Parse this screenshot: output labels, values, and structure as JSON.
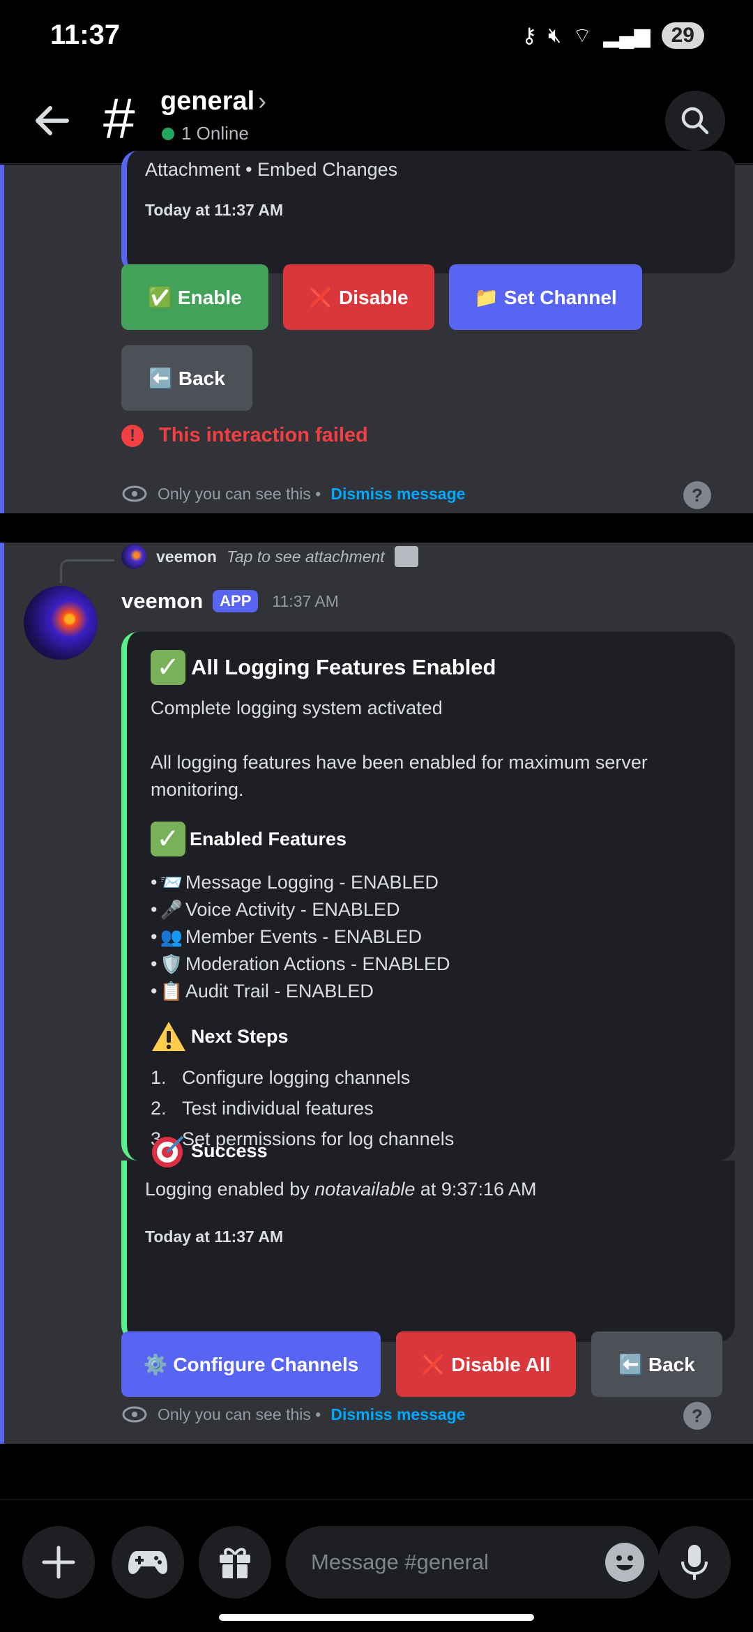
{
  "status_bar": {
    "time": "11:37",
    "battery": "29"
  },
  "header": {
    "channel_name": "general",
    "online": "1 Online"
  },
  "message1": {
    "embed_text": "Attachment • Embed Changes",
    "timestamp": "Today at 11:37 AM",
    "buttons": {
      "enable": "✅ Enable",
      "disable": "❌ Disable",
      "set_channel": "📁 Set Channel",
      "back": "⬅️ Back"
    },
    "failed": "This interaction failed",
    "only_you": "Only you can see this •",
    "dismiss": "Dismiss message"
  },
  "message2": {
    "reply": {
      "name": "veemon",
      "text": "Tap to see attachment"
    },
    "author": "veemon",
    "badge": "APP",
    "time": "11:37 AM",
    "embed": {
      "title": "All Logging Features Enabled",
      "description": "Complete logging system activated",
      "paragraph": "All logging features have been enabled for maximum server monitoring.",
      "features_title": "Enabled Features",
      "features": [
        {
          "emoji": "📨",
          "text": "Message Logging - ENABLED"
        },
        {
          "emoji": "🎤",
          "text": "Voice Activity - ENABLED"
        },
        {
          "emoji": "👥",
          "text": "Member Events - ENABLED"
        },
        {
          "emoji": "🛡️",
          "text": "Moderation Actions - ENABLED"
        },
        {
          "emoji": "📋",
          "text": "Audit Trail - ENABLED"
        }
      ],
      "next_title": "Next Steps",
      "steps": [
        "Configure logging channels",
        "Test individual features",
        "Set permissions for log channels"
      ],
      "success_title": "Success",
      "success_prefix": "Logging enabled by",
      "success_user": "notavailable",
      "success_suffix": "at 9:37:16 AM",
      "timestamp": "Today at 11:37 AM"
    },
    "buttons": {
      "configure": "⚙️ Configure Channels",
      "disable_all": "❌ Disable All",
      "back": "⬅️ Back"
    },
    "only_you": "Only you can see this •",
    "dismiss": "Dismiss message"
  },
  "composer": {
    "placeholder": "Message #general"
  },
  "colors": {
    "blurple": "#5865f2",
    "green": "#43a25a",
    "red": "#da373c",
    "gray": "#4e5058",
    "success_bar": "#57f287"
  }
}
